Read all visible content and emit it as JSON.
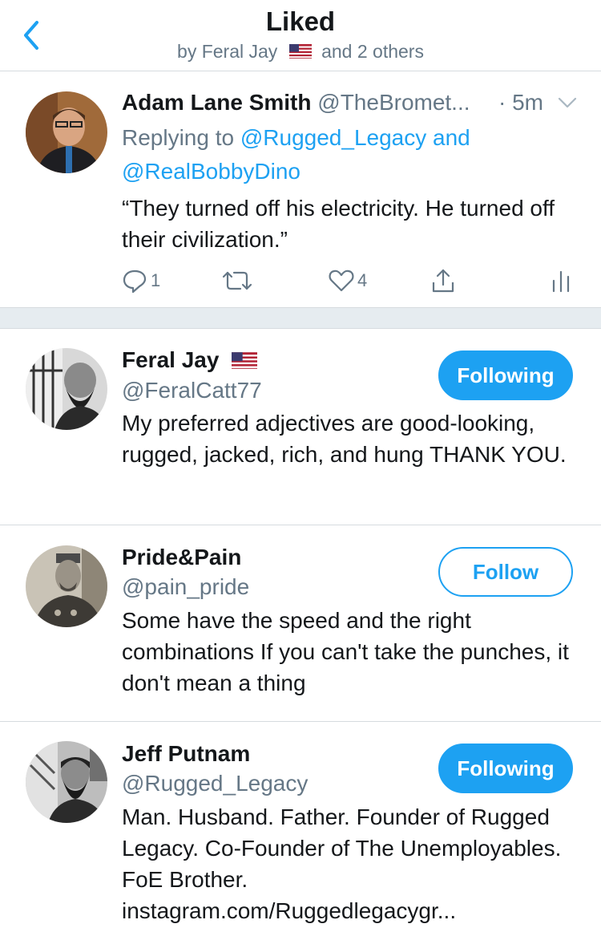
{
  "header": {
    "title": "Liked",
    "subtitle_prefix": "by Feral Jay",
    "subtitle_suffix": "and 2 others",
    "back_icon": "chevron-left-icon"
  },
  "tweet": {
    "name": "Adam Lane Smith",
    "handle": "@TheBromet...",
    "time": "· 5m",
    "reply_prefix": "Replying to",
    "reply_user1": "@Rugged_Legacy",
    "reply_and": "and",
    "reply_user2": "@RealBobbyDino",
    "text": "“They turned off his electricity. He turned off their civilization.”",
    "reply_count": "1",
    "like_count": "4"
  },
  "users": [
    {
      "name": "Feral Jay",
      "has_flag": true,
      "handle": "@FeralCatt77",
      "bio": "My preferred adjectives are good-looking, rugged, jacked, rich, and hung THANK YOU.",
      "button": "Following"
    },
    {
      "name": "Pride&Pain",
      "handle": "@pain_pride",
      "bio": "Some have the speed and the right combinations If you can't take the punches, it don't mean a thing",
      "button": "Follow"
    },
    {
      "name": "Jeff Putnam",
      "handle": "@Rugged_Legacy",
      "bio": "Man. Husband. Father. Founder of Rugged Legacy. Co-Founder of The Unemployables. FoE Brother. instagram.com/Ruggedlegacygr...",
      "button": "Following"
    }
  ],
  "colors": {
    "accent": "#1da1f2",
    "secondary_text": "#657786",
    "divider": "#d6dbdf"
  }
}
